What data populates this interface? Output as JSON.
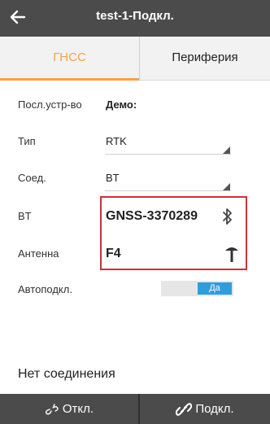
{
  "header": {
    "title": "test-1-Подкл."
  },
  "tabs": {
    "gnss": "ГНСС",
    "peripherals": "Периферия"
  },
  "fields": {
    "device_label": "Посл.устр-во",
    "device_value": "Демо:",
    "type_label": "Тип",
    "type_value": "RTK",
    "conn_label": "Соед.",
    "conn_value": "BT",
    "bt_label": "BT",
    "bt_value": "GNSS-3370289",
    "antenna_label": "Антенна",
    "antenna_value": "F4",
    "autoconnect_label": "Автоподкл.",
    "autoconnect_value": "Да"
  },
  "status": {
    "text": "Нет соединения"
  },
  "bottom": {
    "disconnect_label": "Откл.",
    "connect_label": "Подкл."
  },
  "icons": {
    "back": "arrow-left-icon",
    "bluetooth": "bluetooth-icon",
    "antenna": "antenna-icon",
    "unlink": "unlink-icon",
    "link": "link-icon"
  },
  "colors": {
    "appbar": "#4b4b4b",
    "accent": "#f3a24a",
    "highlight_border": "#c9333b",
    "toggle_on": "#2f9ddc"
  }
}
